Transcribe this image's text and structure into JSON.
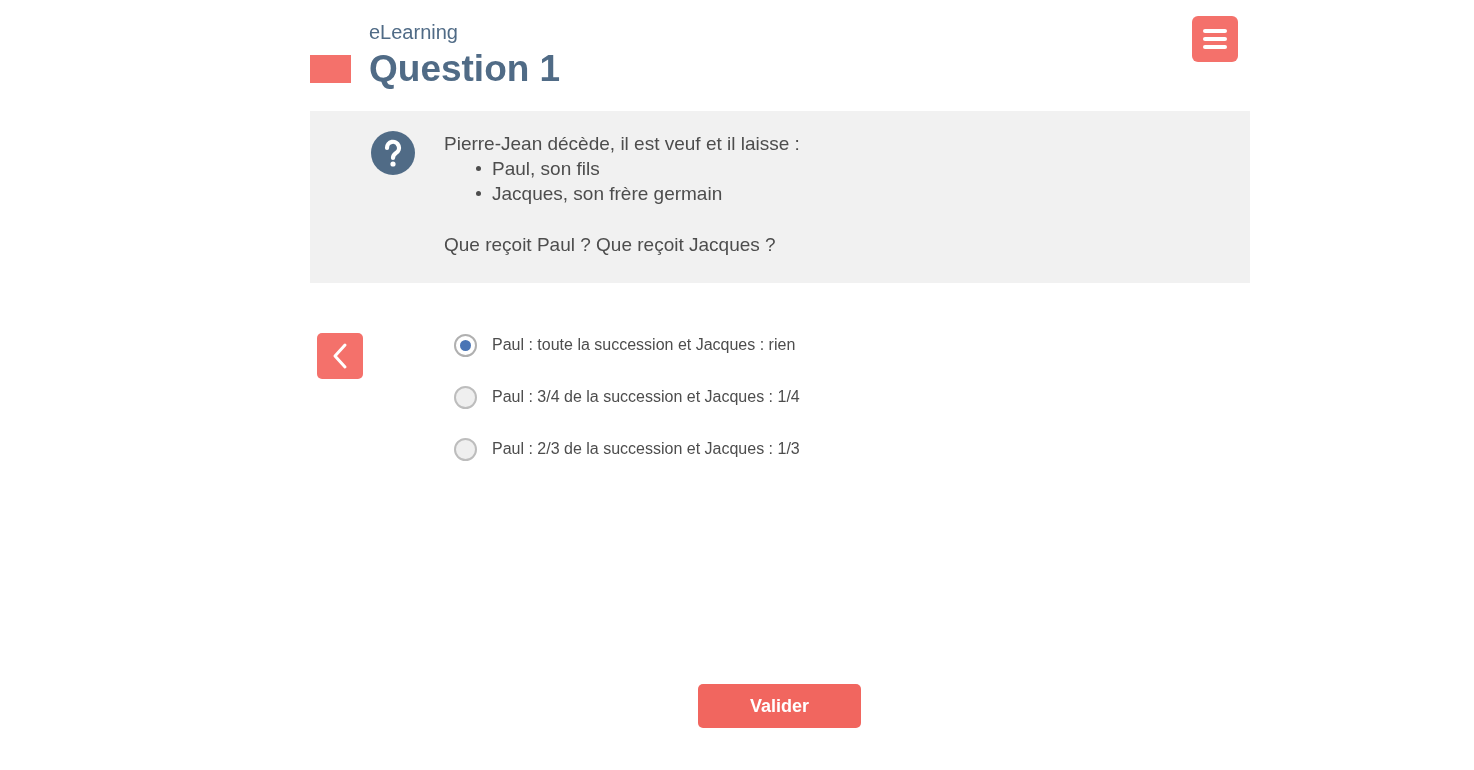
{
  "header": {
    "app_name": "eLearning",
    "title": "Question 1"
  },
  "question": {
    "intro": "Pierre-Jean décède, il est veuf et il laisse :",
    "items": [
      "Paul, son fils",
      "Jacques, son frère germain"
    ],
    "prompt": "Que reçoit Paul ? Que reçoit Jacques ?"
  },
  "options": [
    {
      "label": "Paul : toute la succession et Jacques : rien",
      "selected": true
    },
    {
      "label": "Paul : 3/4 de la succession et Jacques : 1/4",
      "selected": false
    },
    {
      "label": "Paul : 2/3 de la succession et Jacques : 1/3",
      "selected": false
    }
  ],
  "submit_button": "Valider"
}
